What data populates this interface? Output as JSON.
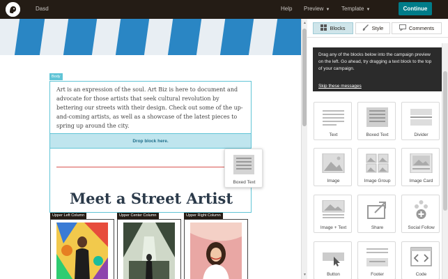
{
  "topbar": {
    "campaign_name": "Dasd",
    "help": "Help",
    "preview": "Preview",
    "template": "Template",
    "continue": "Continue",
    "logo_icon": "freddie-logo-icon",
    "colors": {
      "bar": "#241c15",
      "accent": "#007c89"
    }
  },
  "preview": {
    "body_tag": "Body",
    "body_text": "Art is an expression of the soul. Art Biz is here to document and advocate for those artists that seek cultural revolution by bettering our streets with their design. Check out some of the up-and-coming artists, as well as a showcase of the latest pieces to spring up around the city.",
    "drop_zone": "Drop block here.",
    "heading": "Meet a Street Artist",
    "drag_ghost_label": "Boxed Text",
    "columns": [
      {
        "tag": "Upper Left Column"
      },
      {
        "tag": "Upper Center Column"
      },
      {
        "tag": "Upper Right Column"
      }
    ]
  },
  "panel": {
    "tabs": [
      {
        "label": "Blocks",
        "icon": "blocks-icon",
        "active": true
      },
      {
        "label": "Style",
        "icon": "paintbrush-icon",
        "active": false
      },
      {
        "label": "Comments",
        "icon": "comment-icon",
        "active": false
      }
    ],
    "tooltip": {
      "text": "Drag any of the blocks below into the campaign preview on the left. Go ahead, try dragging a text block to the top of your campaign.",
      "skip": "Skip these messages"
    },
    "blocks": [
      {
        "label": "Text",
        "icon": "text-block-icon"
      },
      {
        "label": "Boxed Text",
        "icon": "boxed-text-icon"
      },
      {
        "label": "Divider",
        "icon": "divider-icon"
      },
      {
        "label": "Image",
        "icon": "image-icon"
      },
      {
        "label": "Image Group",
        "icon": "image-group-icon"
      },
      {
        "label": "Image Card",
        "icon": "image-card-icon"
      },
      {
        "label": "Image + Text",
        "icon": "image-text-icon"
      },
      {
        "label": "Share",
        "icon": "share-icon"
      },
      {
        "label": "Social Follow",
        "icon": "social-follow-icon"
      },
      {
        "label": "Button",
        "icon": "button-icon"
      },
      {
        "label": "Footer",
        "icon": "footer-icon"
      },
      {
        "label": "Code",
        "icon": "code-icon"
      }
    ]
  }
}
